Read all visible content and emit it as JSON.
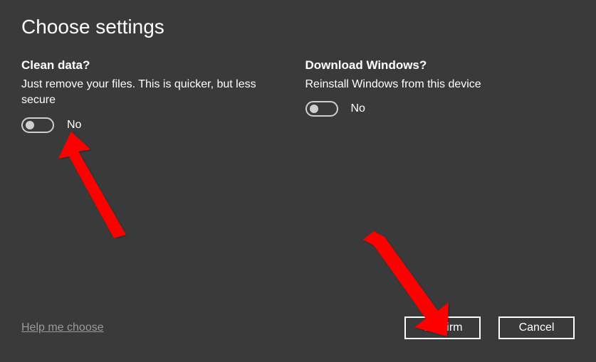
{
  "title": "Choose settings",
  "settings": {
    "clean_data": {
      "heading": "Clean data?",
      "description": "Just remove your files. This is quicker, but less secure",
      "toggle_state": "No"
    },
    "download_windows": {
      "heading": "Download Windows?",
      "description": "Reinstall Windows from this device",
      "toggle_state": "No"
    }
  },
  "footer": {
    "help_link": "Help me choose",
    "confirm_label": "Confirm",
    "cancel_label": "Cancel"
  }
}
